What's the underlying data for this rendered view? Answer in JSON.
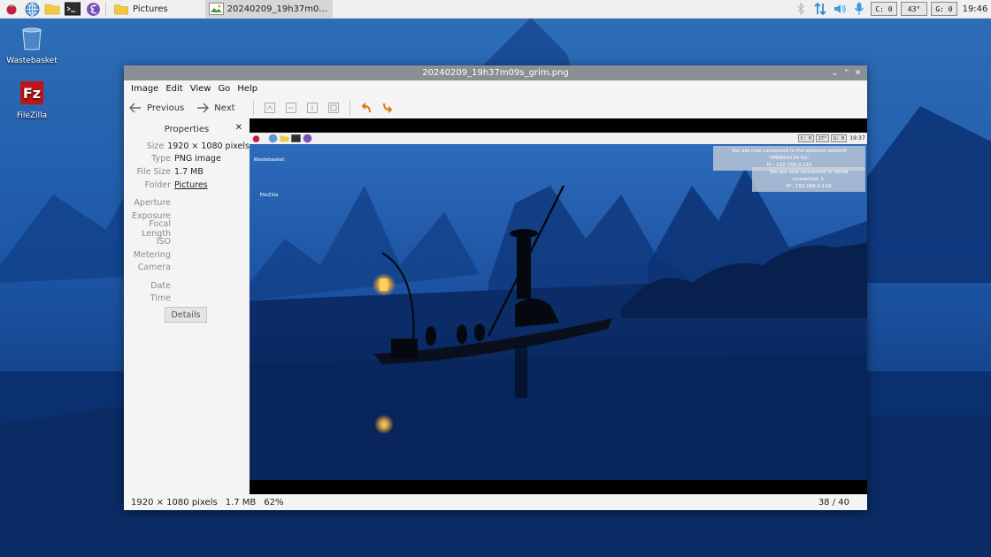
{
  "taskbar": {
    "icons": [
      "raspberry-menu-icon",
      "web-browser-icon",
      "file-manager-icon",
      "terminal-icon",
      "emacs-icon"
    ],
    "tasks": [
      {
        "label": "Pictures",
        "icon": "folder-icon",
        "active": false
      },
      {
        "label": "20240209_19h37m0...",
        "icon": "image-viewer-icon",
        "active": true
      }
    ],
    "tray": {
      "cpu": "C: 0",
      "temp": "43°",
      "gpu": "G: 0",
      "clock": "19:46"
    }
  },
  "desktop": {
    "icons": [
      {
        "label": "Wastebasket",
        "icon": "wastebasket-icon"
      },
      {
        "label": "FileZilla",
        "icon": "filezilla-icon"
      }
    ]
  },
  "window": {
    "title": "20240209_19h37m09s_grim.png",
    "menu": [
      "Image",
      "Edit",
      "View",
      "Go",
      "Help"
    ],
    "toolbar": {
      "previous": "Previous",
      "next": "Next"
    },
    "sidebar": {
      "title": "Properties",
      "props": [
        {
          "key": "Size",
          "value": "1920 × 1080 pixels"
        },
        {
          "key": "Type",
          "value": "PNG image"
        },
        {
          "key": "File Size",
          "value": "1.7 MB"
        },
        {
          "key": "Folder",
          "value": "Pictures"
        }
      ],
      "exif": [
        "Aperture",
        "Exposure",
        "Focal Length",
        "ISO",
        "Metering",
        "Camera"
      ],
      "datetime": [
        "Date",
        "Time"
      ],
      "details_button": "Details"
    },
    "status": {
      "dimensions": "1920 × 1080 pixels",
      "size": "1.7 MB",
      "zoom": "62%",
      "position": "38 / 40"
    }
  },
  "screenshot": {
    "taskbar_meters": [
      "C: 0",
      "27°",
      "G: 0"
    ],
    "clock": "19:37",
    "desktop_labels": [
      "Wastebasket",
      "FileZilla"
    ],
    "notifications": [
      {
        "line1": "You are now connected to the wireless network 'VM0604124-5G'.",
        "line2": "IP : 192.168.0.120"
      },
      {
        "line1": "You are now connected to Wired connection 1.",
        "line2": "IP : 192.168.0.119"
      }
    ]
  }
}
